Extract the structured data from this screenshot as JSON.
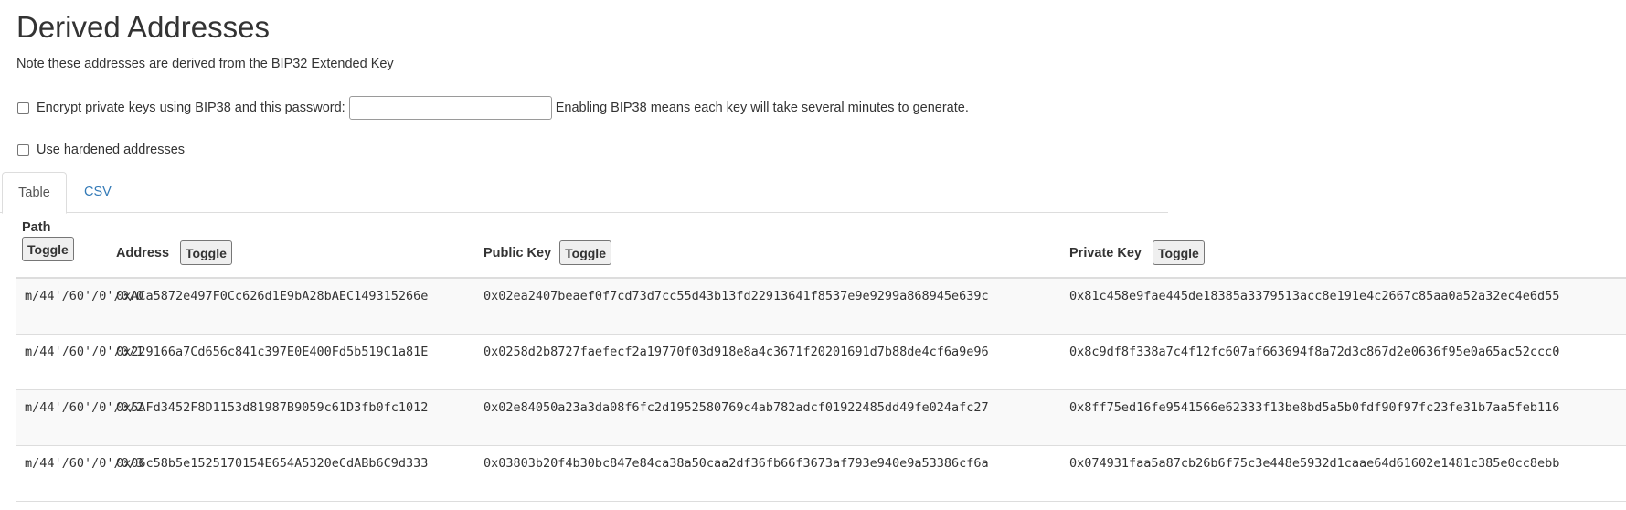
{
  "section": {
    "title": "Derived Addresses",
    "note": "Note these addresses are derived from the BIP32 Extended Key"
  },
  "bip38": {
    "label": "Encrypt private keys using BIP38 and this password:",
    "password_value": "",
    "hint": "Enabling BIP38 means each key will take several minutes to generate."
  },
  "hardened": {
    "label": "Use hardened addresses"
  },
  "tabs": [
    {
      "label": "Table",
      "active": true
    },
    {
      "label": "CSV",
      "active": false
    }
  ],
  "table": {
    "columns": {
      "path": "Path",
      "address": "Address",
      "public_key": "Public Key",
      "private_key": "Private Key"
    },
    "toggle_label": "Toggle",
    "rows": [
      {
        "path": "m/44'/60'/0'/0/0",
        "address": "0xACa5872e497F0Cc626d1E9bA28bAEC149315266e",
        "public_key": "0x02ea2407beaef0f7cd73d7cc55d43b13fd22913641f8537e9e9299a868945e639c",
        "private_key": "0x81c458e9fae445de18385a3379513acc8e191e4c2667c85aa0a52a32ec4e6d55"
      },
      {
        "path": "m/44'/60'/0'/0/1",
        "address": "0x229166a7Cd656c841c397E0E400Fd5b519C1a81E",
        "public_key": "0x0258d2b8727faefecf2a19770f03d918e8a4c3671f20201691d7b88de4cf6a9e96",
        "private_key": "0x8c9df8f338a7c4f12fc607af663694f8a72d3c867d2e0636f95e0a65ac52ccc0"
      },
      {
        "path": "m/44'/60'/0'/0/2",
        "address": "0x5AFd3452F8D1153d81987B9059c61D3fb0fc1012",
        "public_key": "0x02e84050a23a3da08f6fc2d1952580769c4ab782adcf01922485dd49fe024afc27",
        "private_key": "0x8ff75ed16fe9541566e62333f13be8bd5a5b0fdf90f97fc23fe31b7aa5feb116"
      },
      {
        "path": "m/44'/60'/0'/0/3",
        "address": "0x06c58b5e1525170154E654A5320eCdABb6C9d333",
        "public_key": "0x03803b20f4b30bc847e84ca38a50caa2df36fb66f3673af793e940e9a53386cf6a",
        "private_key": "0x074931faa5a87cb26b6f75c3e448e5932d1caae64d61602e1481c385e0cc8ebb"
      }
    ]
  }
}
